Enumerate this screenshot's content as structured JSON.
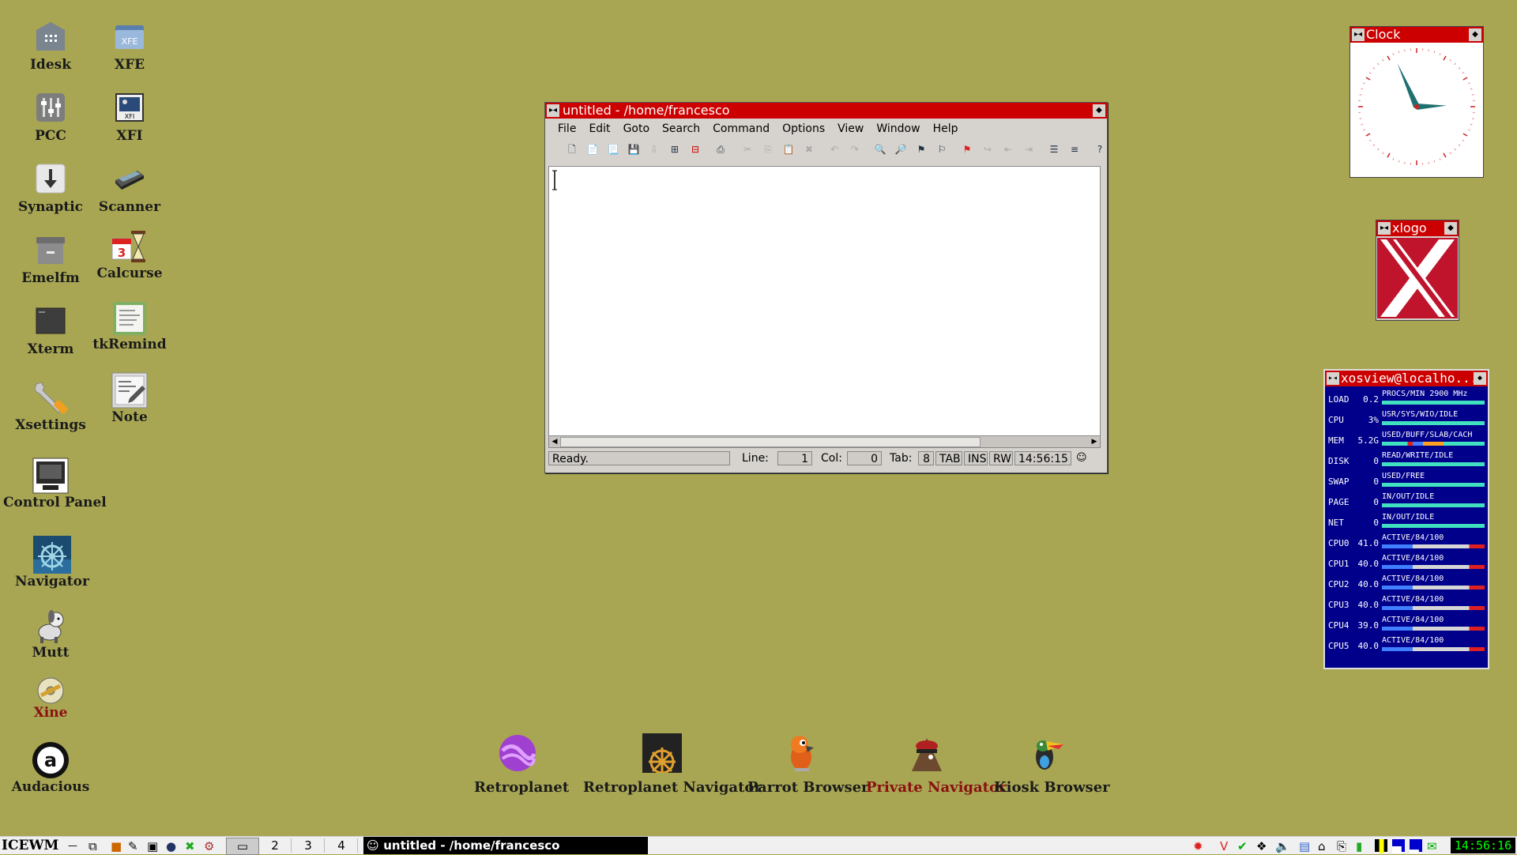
{
  "desktop_icons": [
    {
      "label": "Idesk",
      "icon": "grid-box-icon"
    },
    {
      "label": "XFE",
      "icon": "xfe-folder-icon"
    },
    {
      "label": "PCC",
      "icon": "sliders-icon"
    },
    {
      "label": "XFI",
      "icon": "xfi-image-icon"
    },
    {
      "label": "Synaptic",
      "icon": "download-arrow-icon"
    },
    {
      "label": "Scanner",
      "icon": "scanner-icon"
    },
    {
      "label": "Emelfm",
      "icon": "file-cabinet-icon"
    },
    {
      "label": "Calcurse",
      "icon": "calendar-hourglass-icon"
    },
    {
      "label": "Xterm",
      "icon": "terminal-icon"
    },
    {
      "label": "tkRemind",
      "icon": "reminder-note-icon"
    },
    {
      "label": "Xsettings",
      "icon": "wrench-icon"
    },
    {
      "label": "Note",
      "icon": "notepad-icon"
    },
    {
      "label": "Control Panel",
      "icon": "control-panel-icon"
    },
    {
      "label": "Navigator",
      "icon": "ship-wheel-icon"
    },
    {
      "label": "Mutt",
      "icon": "dog-icon"
    },
    {
      "label": "Xine",
      "icon": "disc-icon"
    },
    {
      "label": "Audacious",
      "icon": "audacious-icon"
    }
  ],
  "launchers": [
    {
      "label": "Retroplanet",
      "icon": "planet-icon"
    },
    {
      "label": "Retroplanet Navigator",
      "icon": "helm-icon"
    },
    {
      "label": "Parrot Browser",
      "icon": "parrot-icon"
    },
    {
      "label": "Private Navigator",
      "icon": "pirate-icon"
    },
    {
      "label": "Kiosk Browser",
      "icon": "toucan-icon"
    }
  ],
  "editor_window": {
    "title": "untitled - /home/francesco",
    "menus": [
      "File",
      "Edit",
      "Goto",
      "Search",
      "Command",
      "Options",
      "View",
      "Window",
      "Help"
    ],
    "status": {
      "message": "Ready.",
      "line_label": "Line:",
      "line_value": "1",
      "col_label": "Col:",
      "col_value": "0",
      "tab_label": "Tab:",
      "tab_value": "8",
      "tab_mode": "TAB",
      "ins": "INS",
      "rw": "RW",
      "time": "14:56:15"
    }
  },
  "clock_window": {
    "title": "Clock",
    "time_hm": [
      14,
      56
    ]
  },
  "xlogo_window": {
    "title": "xlogo"
  },
  "xosview_window": {
    "title": "xosview@localho...",
    "rows": [
      {
        "name": "LOAD",
        "value": "0.2",
        "legend": "PROCS/MIN 2900 MHz"
      },
      {
        "name": "CPU",
        "value": "3%",
        "legend": "USR/SYS/WIO/IDLE"
      },
      {
        "name": "MEM",
        "value": "5.2G",
        "legend": "USED/BUFF/SLAB/CACH"
      },
      {
        "name": "DISK",
        "value": "0",
        "legend": "READ/WRITE/IDLE"
      },
      {
        "name": "SWAP",
        "value": "0",
        "legend": "USED/FREE"
      },
      {
        "name": "PAGE",
        "value": "0",
        "legend": "IN/OUT/IDLE"
      },
      {
        "name": "NET",
        "value": "0",
        "legend": "IN/OUT/IDLE"
      },
      {
        "name": "CPU0",
        "value": "41.0",
        "legend": "ACTIVE/84/100"
      },
      {
        "name": "CPU1",
        "value": "40.0",
        "legend": "ACTIVE/84/100"
      },
      {
        "name": "CPU2",
        "value": "40.0",
        "legend": "ACTIVE/84/100"
      },
      {
        "name": "CPU3",
        "value": "40.0",
        "legend": "ACTIVE/84/100"
      },
      {
        "name": "CPU4",
        "value": "39.0",
        "legend": "ACTIVE/84/100"
      },
      {
        "name": "CPU5",
        "value": "40.0",
        "legend": "ACTIVE/84/100"
      }
    ]
  },
  "taskbar": {
    "logo": "ICEWM",
    "desktops": [
      "2",
      "3",
      "4"
    ],
    "active_task": "untitled - /home/francesco",
    "clock": "14:56:16"
  },
  "colors": {
    "desktop": "#a8a653",
    "titlebar": "#cc0000",
    "xosview_bg": "#00008b"
  }
}
